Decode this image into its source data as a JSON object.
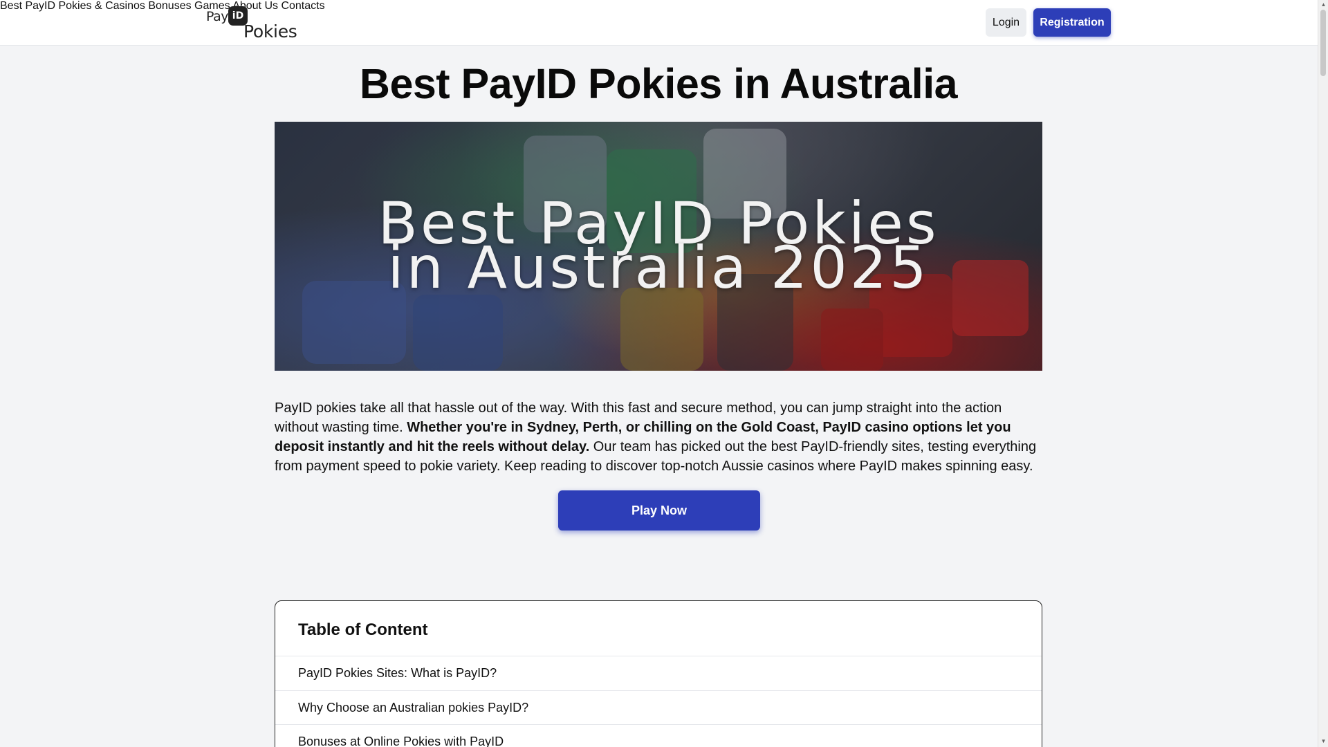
{
  "header": {
    "logo": {
      "pay": "Pay",
      "badge": "iD",
      "pokies": "Pokies"
    },
    "nav": [
      {
        "label": "Best PayID Pokies & Casinos"
      },
      {
        "label": "Bonuses"
      },
      {
        "label": "Games"
      },
      {
        "label": "About Us"
      },
      {
        "label": "Contacts"
      }
    ],
    "login_label": "Login",
    "registration_label": "Registration"
  },
  "main": {
    "title": "Best PayID Pokies in Australia",
    "hero": {
      "line1": "Best PayID Pokies",
      "line2": "in Australia 2025"
    },
    "intro": {
      "part1": "PayID pokies take all that hassle out of the way. With this fast and secure method, you can jump straight into the action without wasting time. ",
      "bold": "Whether you're in Sydney, Perth, or chilling on the Gold Coast, PayID casino options let you deposit instantly and hit the reels without delay.",
      "part2": " Our team has picked out the best PayID-friendly sites, testing everything from payment speed to pokie variety. Keep reading to discover top-notch Aussie casinos where PayID makes spinning easy."
    },
    "play_label": "Play Now"
  },
  "toc": {
    "title": "Table of Content",
    "items": [
      {
        "label": "PayID Pokies Sites: What is PayID?"
      },
      {
        "label": "Why Choose an Australian pokies PayID?"
      },
      {
        "label": "Bonuses at Online Pokies with PayID"
      }
    ]
  },
  "colors": {
    "accent": "#2d3eb8",
    "background": "#f3f4f6"
  }
}
